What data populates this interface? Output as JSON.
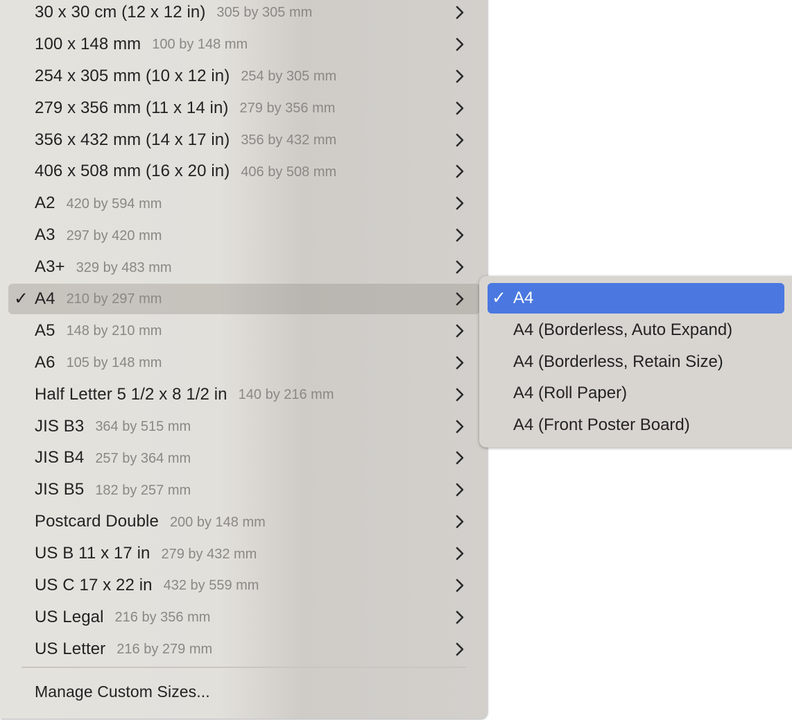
{
  "paper_size_menu": {
    "items": [
      {
        "name": "30 x 30 cm (12 x 12 in)",
        "dimensions": "305 by 305 mm",
        "checked": false
      },
      {
        "name": "100 x 148 mm",
        "dimensions": "100 by 148 mm",
        "checked": false
      },
      {
        "name": "254 x 305 mm (10 x 12 in)",
        "dimensions": "254 by 305 mm",
        "checked": false
      },
      {
        "name": "279 x 356 mm (11 x 14 in)",
        "dimensions": "279 by 356 mm",
        "checked": false
      },
      {
        "name": "356 x 432 mm (14 x 17 in)",
        "dimensions": "356 by 432 mm",
        "checked": false
      },
      {
        "name": "406 x 508 mm (16 x 20 in)",
        "dimensions": "406 by 508 mm",
        "checked": false
      },
      {
        "name": "A2",
        "dimensions": "420 by 594 mm",
        "checked": false
      },
      {
        "name": "A3",
        "dimensions": "297 by 420 mm",
        "checked": false
      },
      {
        "name": "A3+",
        "dimensions": "329 by 483 mm",
        "checked": false
      },
      {
        "name": "A4",
        "dimensions": "210 by 297 mm",
        "checked": true
      },
      {
        "name": "A5",
        "dimensions": "148 by 210 mm",
        "checked": false
      },
      {
        "name": "A6",
        "dimensions": "105 by 148 mm",
        "checked": false
      },
      {
        "name": "Half Letter 5 1/2 x 8 1/2 in",
        "dimensions": "140 by 216 mm",
        "checked": false
      },
      {
        "name": "JIS B3",
        "dimensions": "364 by 515 mm",
        "checked": false
      },
      {
        "name": "JIS B4",
        "dimensions": "257 by 364 mm",
        "checked": false
      },
      {
        "name": "JIS B5",
        "dimensions": "182 by 257 mm",
        "checked": false
      },
      {
        "name": "Postcard Double",
        "dimensions": "200 by 148 mm",
        "checked": false
      },
      {
        "name": "US B 11 x 17 in",
        "dimensions": "279 by 432 mm",
        "checked": false
      },
      {
        "name": "US C 17 x 22 in",
        "dimensions": "432 by 559 mm",
        "checked": false
      },
      {
        "name": "US Legal",
        "dimensions": "216 by 356 mm",
        "checked": false
      },
      {
        "name": "US Letter",
        "dimensions": "216 by 279 mm",
        "checked": false
      }
    ],
    "check_mark": "✓",
    "submenu_icon": "chevron-right-icon",
    "manage_label": "Manage Custom Sizes..."
  },
  "a4_submenu": {
    "items": [
      {
        "label": "A4",
        "checked": true
      },
      {
        "label": "A4 (Borderless, Auto Expand)",
        "checked": false
      },
      {
        "label": "A4 (Borderless, Retain Size)",
        "checked": false
      },
      {
        "label": "A4 (Roll Paper)",
        "checked": false
      },
      {
        "label": "A4 (Front Poster Board)",
        "checked": false
      }
    ],
    "highlight_color": "#4a78e0"
  }
}
